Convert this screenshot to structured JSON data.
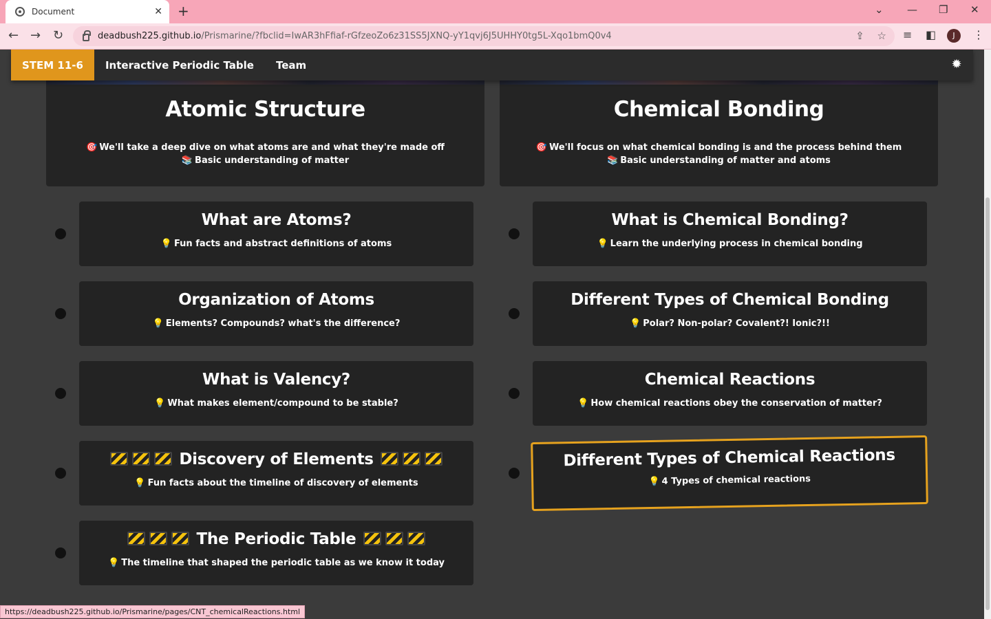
{
  "browser": {
    "tab_title": "Document",
    "tab_close": "✕",
    "new_tab": "+",
    "url_host": "deadbush225.github.io",
    "url_rest": "/Prismarine/?fbclid=IwAR3hFfiaf-rGfzeoZo6z31SS5JXNQ-yY1qvj6J5UHHY0tg5L-Xqo1bmQ0v4",
    "profile_initial": "J",
    "status_url": "https://deadbush225.github.io/Prismarine/pages/CNT_chemicalReactions.html"
  },
  "navbar": {
    "brand": "STEM 11-6",
    "links": [
      "Interactive Periodic Table",
      "Team"
    ]
  },
  "heroes": [
    {
      "title": "Atomic Structure",
      "line1": "We'll take a deep dive on what atoms are and what they're made off",
      "line2": "Basic understanding of matter"
    },
    {
      "title": "Chemical Bonding",
      "line1": "We'll focus on what chemical bonding is and the process behind them",
      "line2": "Basic understanding of matter and atoms"
    }
  ],
  "left_cards": [
    {
      "title": "What are Atoms?",
      "sub": "Fun facts and abstract definitions of atoms",
      "under_construction": false
    },
    {
      "title": "Organization of Atoms",
      "sub": "Elements? Compounds? what's the difference?",
      "under_construction": false
    },
    {
      "title": "What is Valency?",
      "sub": "What makes element/compound to be stable?",
      "under_construction": false
    },
    {
      "title": "Discovery of Elements",
      "sub": "Fun facts about the timeline of discovery of elements",
      "under_construction": true
    },
    {
      "title": "The Periodic Table",
      "sub": "The timeline that shaped the periodic table as we know it today",
      "under_construction": true
    }
  ],
  "right_cards": [
    {
      "title": "What is Chemical Bonding?",
      "sub": "Learn the underlying process in chemical bonding"
    },
    {
      "title": "Different Types of Chemical Bonding",
      "sub": "Polar? Non-polar? Covalent?! Ionic?!!"
    },
    {
      "title": "Chemical Reactions",
      "sub": "How chemical reactions obey the conservation of matter?"
    },
    {
      "title": "Different Types of Chemical Reactions",
      "sub": "4 Types of chemical reactions"
    }
  ],
  "colors": {
    "brand": "#e0961c",
    "active_border": "#e6a21e",
    "card_bg": "#232323",
    "page_bg": "#3b3b3b"
  }
}
